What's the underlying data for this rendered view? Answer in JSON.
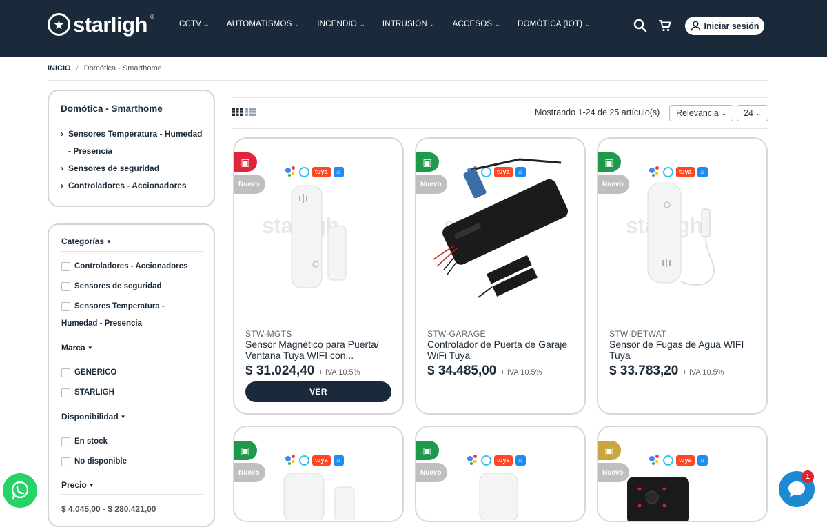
{
  "header": {
    "logo_text": "starligh",
    "logo_reg": "®",
    "nav": [
      {
        "label": "CCTV"
      },
      {
        "label": "AUTOMATISMOS"
      },
      {
        "label": "INCENDIO"
      },
      {
        "label": "INTRUSIÓN"
      },
      {
        "label": "ACCESOS"
      },
      {
        "label": "DOMÓTICA (IOT)"
      }
    ],
    "login_label": "Iniciar sesión",
    "icons": [
      "search-icon",
      "cart-icon",
      "user-icon"
    ]
  },
  "breadcrumb": {
    "home": "INICIO",
    "separator": "/",
    "current": "Domótica - Smarthome"
  },
  "sidebar": {
    "category_title": "Domótica - Smarthome",
    "category_links": [
      "Sensores Temperatura - Humedad - Presencia",
      "Sensores de seguridad",
      "Controladores - Accionadores"
    ],
    "filters": {
      "categorias": {
        "title": "Categorías",
        "options": [
          "Controladores - Accionadores",
          "Sensores de seguridad",
          "Sensores Temperatura - Humedad - Presencia"
        ]
      },
      "marca": {
        "title": "Marca",
        "options": [
          "GENERICO",
          "STARLIGH"
        ]
      },
      "disponibilidad": {
        "title": "Disponibilidad",
        "options": [
          "En stock",
          "No disponible"
        ]
      },
      "precio": {
        "title": "Precio",
        "range": "$ 4.045,00 - $ 280.421,00"
      }
    }
  },
  "listing": {
    "result_text": "Mostrando 1-24 de 25 artículo(s)",
    "sort_label": "Relevancia",
    "per_page": "24",
    "new_label": "Nuevo",
    "view_button": "VER",
    "iva_label": "+ IVA 10.5%",
    "watermark": "starligh",
    "compat": {
      "tuya": "tuya"
    },
    "products": [
      {
        "code": "STW-MGTS",
        "name": "Sensor Magnético para Puerta/ Ventana Tuya WIFI con...",
        "price": "$ 31.024,40",
        "badge_color": "#e0243c"
      },
      {
        "code": "STW-GARAGE",
        "name": "Controlador de Puerta de Garaje WiFi Tuya",
        "price": "$ 34.485,00",
        "badge_color": "#1f9a4a"
      },
      {
        "code": "STW-DETWAT",
        "name": "Sensor de Fugas de Agua WIFI Tuya",
        "price": "$ 33.783,20",
        "badge_color": "#1f9a4a"
      },
      {
        "badge_color": "#1f9a4a"
      },
      {
        "badge_color": "#1f9a4a"
      },
      {
        "badge_color": "#c9a640"
      }
    ]
  },
  "floating": {
    "chat_badge_count": "1"
  },
  "colors": {
    "header_bg": "#1b2a3b",
    "whatsapp": "#25d366",
    "chat": "#1b8ad3"
  }
}
